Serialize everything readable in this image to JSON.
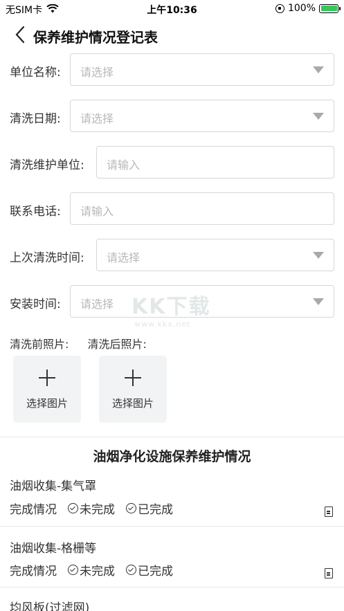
{
  "status_bar": {
    "carrier": "无SIM卡",
    "time": "上午10:36",
    "battery": "100%"
  },
  "nav": {
    "title": "保养维护情况登记表"
  },
  "form": {
    "unit_name": {
      "label": "单位名称:",
      "placeholder": "请选择"
    },
    "clean_date": {
      "label": "清洗日期:",
      "placeholder": "请选择"
    },
    "maintain_unit": {
      "label": "清洗维护单位:",
      "placeholder": "请输入"
    },
    "phone": {
      "label": "联系电话:",
      "placeholder": "请输入"
    },
    "last_clean": {
      "label": "上次清洗时间:",
      "placeholder": "请选择"
    },
    "install_time": {
      "label": "安装时间:",
      "placeholder": "请选择"
    }
  },
  "photos": {
    "before_label": "清洗前照片:",
    "after_label": "清洗后照片:",
    "select_label": "选择图片"
  },
  "section": {
    "title": "油烟净化设施保养维护情况",
    "items": [
      {
        "title": "油烟收集-集气罩",
        "status_label": "完成情况",
        "opt_incomplete": "未完成",
        "opt_complete": "已完成"
      },
      {
        "title": "油烟收集-格栅等",
        "status_label": "完成情况",
        "opt_incomplete": "未完成",
        "opt_complete": "已完成"
      },
      {
        "title": "均风板(过滤网)"
      }
    ]
  },
  "watermark": {
    "brand": "KK下载",
    "url": "www.kkx.net"
  }
}
